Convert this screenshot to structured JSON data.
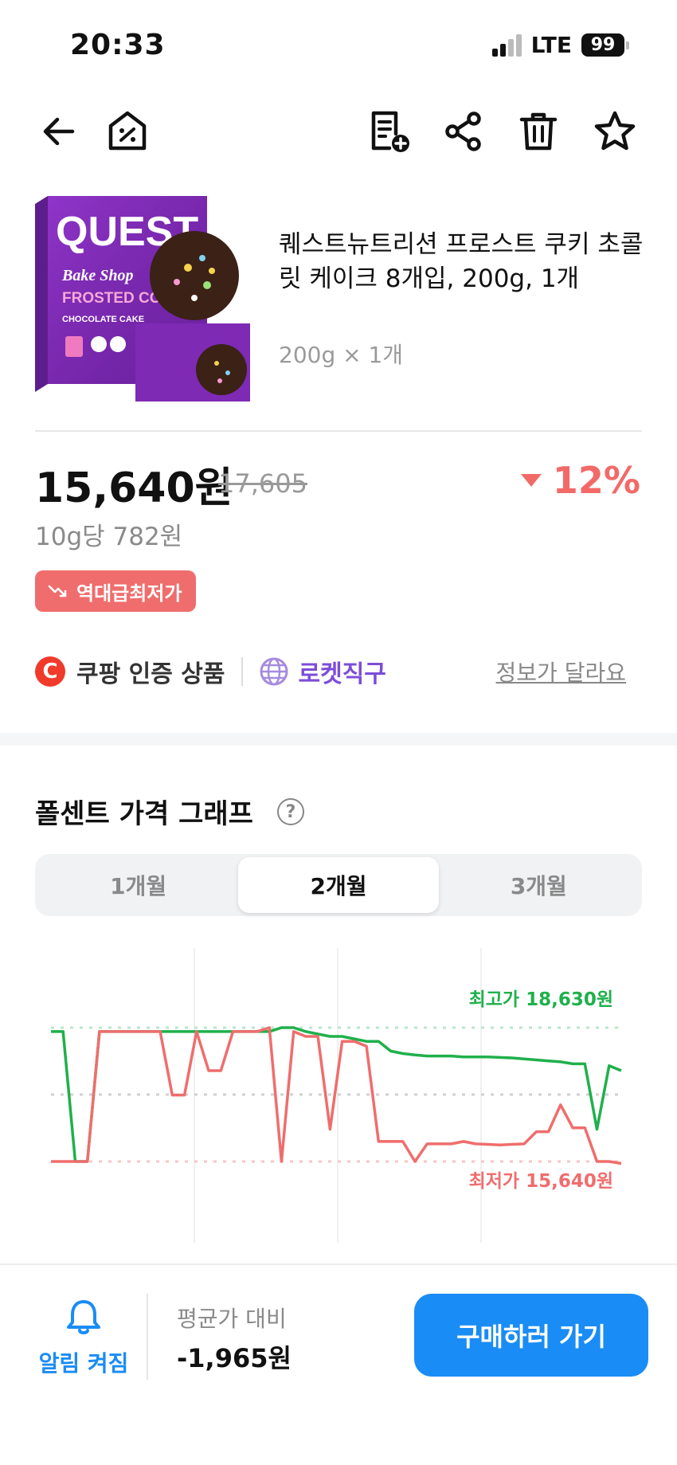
{
  "status": {
    "time": "20:33",
    "network": "LTE",
    "battery": "99"
  },
  "toolbar": {
    "back_icon": "arrow-left-icon",
    "deal_home_icon": "percent-house-icon",
    "add_list_icon": "list-add-icon",
    "share_icon": "share-icon",
    "delete_icon": "trash-icon",
    "favorite_icon": "star-icon"
  },
  "product": {
    "title": "퀘스트뉴트리션 프로스트 쿠키 초콜릿 케이크 8개입, 200g, 1개",
    "subtitle": "200g × 1개",
    "image_brand": "QUEST",
    "image_line": "Bake Shop",
    "image_name": "FROSTED COOKIES",
    "image_flavor": "CHOCOLATE CAKE"
  },
  "price": {
    "current": "15,640원",
    "original": "17,605",
    "discount": "12%",
    "unit": "10g당 782원",
    "badge": "역대급최저가"
  },
  "cert": {
    "coupang_icon": "C",
    "coupang_label": "쿠팡 인증 상품",
    "rocket_label": "로켓직구",
    "report_link": "정보가 달라요"
  },
  "graph": {
    "title": "폴센트 가격 그래프",
    "help": "?",
    "tabs": [
      "1개월",
      "2개월",
      "3개월"
    ],
    "active_tab": "2개월"
  },
  "chart_data": {
    "type": "line",
    "max_label": "최고가 18,630원",
    "min_label": "최저가 15,640원",
    "max_value": 18630,
    "min_value": 15640,
    "colors": {
      "high": "#1fb04b",
      "low": "#f06d6d",
      "mid_line": "#cccccc"
    },
    "series": [
      {
        "color": "#1fb04b",
        "values": [
          18300,
          18300,
          15640,
          15640,
          18300,
          18300,
          18300,
          18300,
          18300,
          18300,
          18300,
          18300,
          18300,
          18300,
          18300,
          18300,
          18300,
          18300,
          18300,
          18380,
          18380,
          18300,
          18250,
          18200,
          18200,
          18150,
          18100,
          18100,
          17900,
          17850,
          17820,
          17800,
          17800,
          17800,
          17780,
          17780,
          17780,
          17770,
          17760,
          17740,
          17720,
          17700,
          17680,
          17640,
          17640,
          16300,
          17600,
          17500
        ]
      },
      {
        "color": "#f06d6d",
        "values": [
          15640,
          15640,
          15640,
          15640,
          18300,
          18300,
          18300,
          18300,
          18300,
          18300,
          17000,
          17000,
          18300,
          17500,
          17500,
          18300,
          18300,
          18300,
          18380,
          15640,
          18300,
          18200,
          18200,
          16300,
          18100,
          18100,
          18000,
          16050,
          16050,
          16050,
          15640,
          16000,
          16000,
          16000,
          16050,
          16000,
          15990,
          15980,
          15990,
          16000,
          16250,
          16250,
          16800,
          16330,
          16330,
          15640,
          15640,
          15600
        ]
      }
    ]
  },
  "bottom": {
    "alarm_label": "알림 켜짐",
    "avg_label": "평균가 대비",
    "avg_value": "-1,965원",
    "buy_label": "구매하러 가기"
  }
}
